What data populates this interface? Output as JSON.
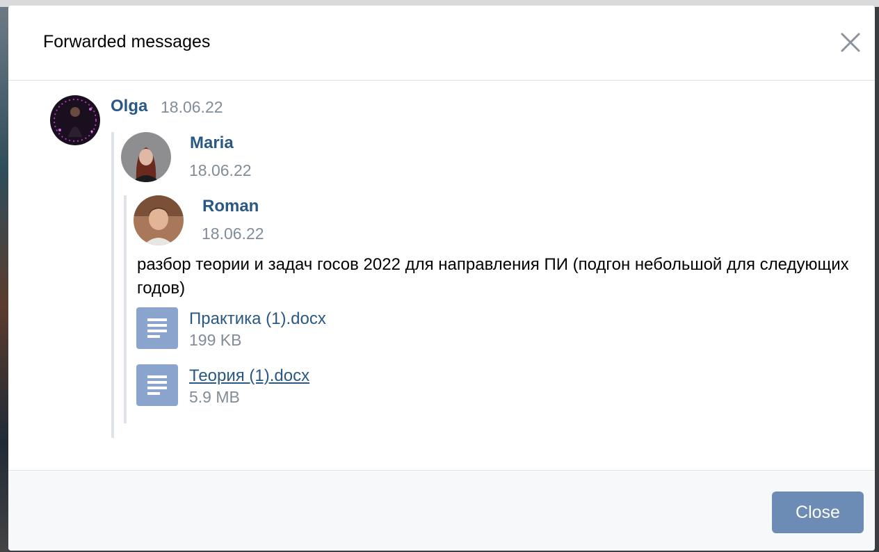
{
  "modal": {
    "title": "Forwarded messages",
    "close_button": "Close"
  },
  "messages": {
    "olga": {
      "author": "Olga",
      "date": "18.06.22"
    },
    "maria": {
      "author": "Maria",
      "date": "18.06.22"
    },
    "roman": {
      "author": "Roman",
      "date": "18.06.22",
      "text": "разбор теории и задач госов 2022 для направления ПИ (подгон небольшой для следующих годов)",
      "documents": [
        {
          "name": "Практика (1).docx",
          "size": "199 KB"
        },
        {
          "name": "Теория (1).docx",
          "size": "5.9 MB"
        }
      ]
    }
  },
  "icons": {
    "close": "close-icon",
    "document": "document-icon"
  },
  "colors": {
    "link": "#2a5885",
    "button": "#6d8cb5",
    "doc_icon": "#8aa4cd",
    "muted": "#818c99"
  }
}
